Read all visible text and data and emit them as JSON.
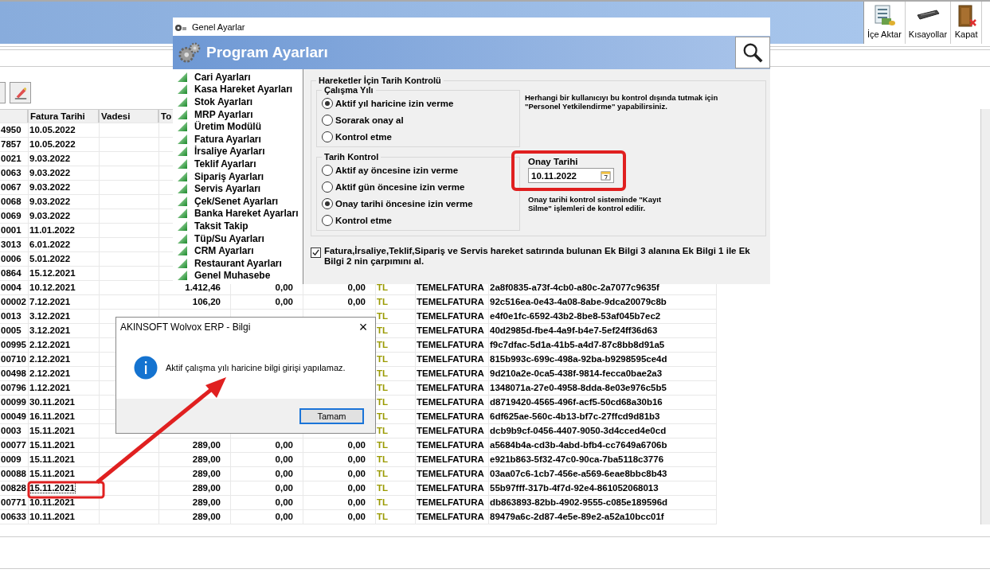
{
  "toolbar": [
    {
      "label": "İçe Aktar",
      "kind": "import"
    },
    {
      "label": "Kısayollar",
      "kind": "keyboard"
    },
    {
      "label": "Kapat",
      "kind": "door"
    }
  ],
  "table": {
    "columns": [
      "Fatura Tarihi",
      "Vadesi",
      "To"
    ],
    "rows": [
      {
        "column_1": "4950",
        "fatura_tarihi": "10.05.2022",
        "selected": false
      },
      {
        "column_1": "7857",
        "fatura_tarihi": "10.05.2022",
        "selected": false
      },
      {
        "column_1": "0021",
        "fatura_tarihi": "9.03.2022",
        "selected": false
      },
      {
        "column_1": "0063",
        "fatura_tarihi": "9.03.2022",
        "selected": false
      },
      {
        "column_1": "0067",
        "fatura_tarihi": "9.03.2022",
        "selected": false
      },
      {
        "column_1": "0068",
        "fatura_tarihi": "9.03.2022",
        "selected": false
      },
      {
        "column_1": "0069",
        "fatura_tarihi": "9.03.2022",
        "selected": false
      },
      {
        "column_1": "0001",
        "fatura_tarihi": "11.01.2022",
        "selected": false
      },
      {
        "column_1": "3013",
        "fatura_tarihi": "6.01.2022",
        "selected": false
      },
      {
        "column_1": "0006",
        "fatura_tarihi": "5.01.2022",
        "selected": false
      },
      {
        "column_1": "0864",
        "fatura_tarihi": "15.12.2021",
        "selected": false
      },
      {
        "column_1": "0004",
        "fatura_tarihi": "10.12.2021",
        "column_4": "1.412,46",
        "column_5": "0,00",
        "column_6": "0,00",
        "column_7": "TL",
        "column_8": "TEMELFATURA",
        "column_9": "2a8f0835-a73f-4cb0-a80c-2a7077c9635f",
        "selected": false
      },
      {
        "column_1": "00002",
        "fatura_tarihi": "7.12.2021",
        "column_4": "106,20",
        "column_5": "0,00",
        "column_6": "0,00",
        "column_7": "TL",
        "column_8": "TEMELFATURA",
        "column_9": "92c516ea-0e43-4a08-8abe-9dca20079c8b",
        "selected": false
      },
      {
        "column_1": "0013",
        "fatura_tarihi": "3.12.2021",
        "column_7": "TL",
        "column_8": "TEMELFATURA",
        "column_9": "e4f0e1fc-6592-43b2-8be8-53af045b7ec2",
        "selected": false
      },
      {
        "column_1": "0005",
        "fatura_tarihi": "3.12.2021",
        "column_7": "TL",
        "column_8": "TEMELFATURA",
        "column_9": "40d2985d-fbe4-4a9f-b4e7-5ef24ff36d63",
        "selected": false
      },
      {
        "column_1": "00995",
        "fatura_tarihi": "2.12.2021",
        "column_7": "TL",
        "column_8": "TEMELFATURA",
        "column_9": "f9c7dfac-5d1a-41b5-a4d7-87c8bb8d91a5",
        "selected": false
      },
      {
        "column_1": "00710",
        "fatura_tarihi": "2.12.2021",
        "column_7": "TL",
        "column_8": "TEMELFATURA",
        "column_9": "815b993c-699c-498a-92ba-b9298595ce4d",
        "selected": false
      },
      {
        "column_1": "00498",
        "fatura_tarihi": "2.12.2021",
        "column_7": "TL",
        "column_8": "TEMELFATURA",
        "column_9": "9d210a2e-0ca5-438f-9814-fecca0bae2a3",
        "selected": false
      },
      {
        "column_1": "00796",
        "fatura_tarihi": "1.12.2021",
        "column_7": "TL",
        "column_8": "TEMELFATURA",
        "column_9": "1348071a-27e0-4958-8dda-8e03e976c5b5",
        "selected": false
      },
      {
        "column_1": "00099",
        "fatura_tarihi": "30.11.2021",
        "column_7": "TL",
        "column_8": "TEMELFATURA",
        "column_9": "d8719420-4565-496f-acf5-50cd68a30b16",
        "selected": false
      },
      {
        "column_1": "00049",
        "fatura_tarihi": "16.11.2021",
        "column_7": "TL",
        "column_8": "TEMELFATURA",
        "column_9": "6df625ae-560c-4b13-bf7c-27ffcd9d81b3",
        "selected": false
      },
      {
        "column_1": "0003",
        "fatura_tarihi": "15.11.2021",
        "column_7": "TL",
        "column_8": "TEMELFATURA",
        "column_9": "dcb9b9cf-0456-4407-9050-3d4cced4e0cd",
        "selected": false
      },
      {
        "column_1": "00077",
        "fatura_tarihi": "15.11.2021",
        "column_4": "289,00",
        "column_5": "0,00",
        "column_6": "0,00",
        "column_7": "TL",
        "column_8": "TEMELFATURA",
        "column_9": "a5684b4a-cd3b-4abd-bfb4-cc7649a6706b",
        "selected": false
      },
      {
        "column_1": "0009",
        "fatura_tarihi": "15.11.2021",
        "column_4": "289,00",
        "column_5": "0,00",
        "column_6": "0,00",
        "column_7": "TL",
        "column_8": "TEMELFATURA",
        "column_9": "e921b863-5f32-47c0-90ca-7ba5118c3776",
        "selected": false
      },
      {
        "column_1": "00088",
        "fatura_tarihi": "15.11.2021",
        "column_4": "289,00",
        "column_5": "0,00",
        "column_6": "0,00",
        "column_7": "TL",
        "column_8": "TEMELFATURA",
        "column_9": "03aa07c6-1cb7-456e-a569-6eae8bbc8b43",
        "selected": false
      },
      {
        "column_1": "00828",
        "fatura_tarihi": "15.11.2021",
        "column_4": "289,00",
        "column_5": "0,00",
        "column_6": "0,00",
        "column_7": "TL",
        "column_8": "TEMELFATURA",
        "column_9": "55b97fff-317b-4f7d-92e4-861052068013",
        "selected": true
      },
      {
        "column_1": "00771",
        "fatura_tarihi": "10.11.2021",
        "column_4": "289,00",
        "column_5": "0,00",
        "column_6": "0,00",
        "column_7": "TL",
        "column_8": "TEMELFATURA",
        "column_9": "db863893-82bb-4902-9555-c085e189596d",
        "selected": false
      },
      {
        "column_1": "00633",
        "fatura_tarihi": "10.11.2021",
        "column_4": "289,00",
        "column_5": "0,00",
        "column_6": "0,00",
        "column_7": "TL",
        "column_8": "TEMELFATURA",
        "column_9": "89479a6c-2d87-4e5e-89e2-a52a10bcc01f",
        "selected": false
      }
    ]
  },
  "settings": {
    "title": "Genel Ayarlar",
    "header": "Program Ayarları",
    "menu": [
      {
        "label": "Cari Ayarları",
        "selected": false
      },
      {
        "label": "Kasa Hareket Ayarları",
        "selected": false
      },
      {
        "label": "Stok Ayarları",
        "selected": false
      },
      {
        "label": "MRP Ayarları",
        "selected": false
      },
      {
        "label": "Üretim Modülü",
        "selected": false
      },
      {
        "label": "Fatura Ayarları",
        "selected": false
      },
      {
        "label": "İrsaliye Ayarları",
        "selected": false
      },
      {
        "label": "Teklif Ayarları",
        "selected": false
      },
      {
        "label": "Sipariş Ayarları",
        "selected": false
      },
      {
        "label": "Servis Ayarları",
        "selected": false
      },
      {
        "label": "Çek/Senet Ayarları",
        "selected": false
      },
      {
        "label": "Banka Hareket Ayarları",
        "selected": false
      },
      {
        "label": "Taksit Takip",
        "selected": false
      },
      {
        "label": "Tüp/Su Ayarları",
        "selected": false
      },
      {
        "label": "CRM Ayarları",
        "selected": false
      },
      {
        "label": "Restaurant Ayarları",
        "selected": false
      },
      {
        "label": "Genel Muhasebe",
        "selected": false
      }
    ],
    "group_title": "Hareketler İçin Tarih Kontrolü",
    "groups": [
      {
        "title": "Çalışma Yılı",
        "options": [
          {
            "label": "Aktif yıl haricine izin verme",
            "selected": true
          },
          {
            "label": "Sorarak onay al",
            "selected": false
          },
          {
            "label": "Kontrol etme",
            "selected": false
          }
        ]
      },
      {
        "title": "Tarih Kontrol",
        "options": [
          {
            "label": "Aktif ay öncesine izin verme",
            "selected": false
          },
          {
            "label": "Aktif gün öncesine izin verme",
            "selected": false
          },
          {
            "label": "Onay tarihi öncesine izin verme",
            "selected": true
          },
          {
            "label": "Kontrol etme",
            "selected": false
          }
        ]
      }
    ],
    "note": "Herhangi bir kullanıcıyı bu kontrol dışında tutmak için \"Personel Yetkilendirme\" yapabilirsiniz.",
    "date_label": "Onay Tarihi",
    "date_value": "10.11.2022",
    "date_note": "Onay tarihi kontrol sisteminde \"Kayıt Silme\" işlemleri de kontrol edilir.",
    "checkbox": {
      "label": "Fatura,İrsaliye,Teklif,Sipariş ve Servis hareket satırında bulunan Ek Bilgi 3 alanına Ek Bilgi 1 ile Ek Bilgi 2 nin çarpımını al.",
      "checked": true
    }
  },
  "dialog": {
    "title": "AKINSOFT Wolvox ERP - Bilgi",
    "close": "×",
    "message": "Aktif çalışma yılı haricine bilgi girişi yapılamaz.",
    "button": "Tamam"
  }
}
